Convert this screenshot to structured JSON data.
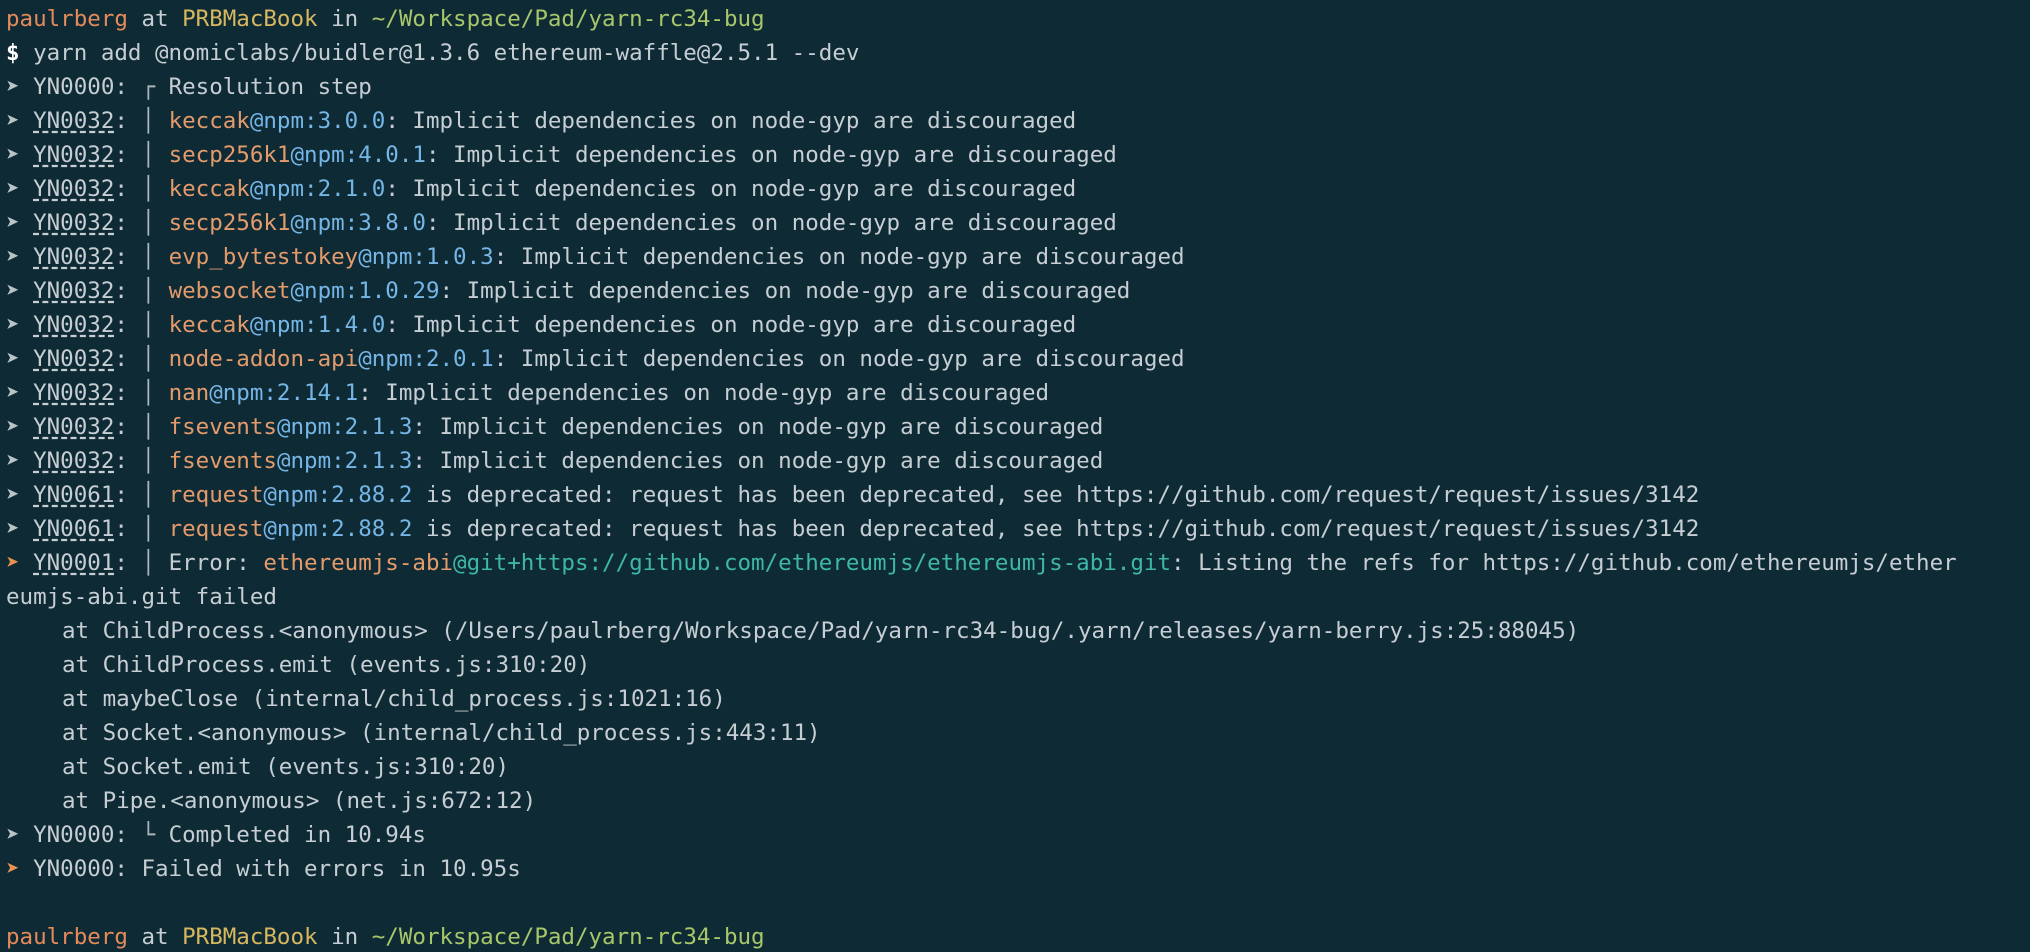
{
  "prompt": {
    "user": "paulrberg",
    "at": "at",
    "host": "PRBMacBook",
    "in": "in",
    "path": "~/Workspace/Pad/yarn-rc34-bug"
  },
  "command": {
    "prefix": "$",
    "text": "yarn add @nomiclabs/buidler@1.3.6 ethereum-waffle@2.5.1 --dev"
  },
  "steps": [
    {
      "code": "YN0000",
      "sep": ":",
      "pipe": "┌",
      "text": "Resolution step"
    }
  ],
  "warnings": [
    {
      "code": "YN0032",
      "name": "keccak",
      "ver": "@npm:3.0.0",
      "msg": ": Implicit dependencies on node-gyp are discouraged"
    },
    {
      "code": "YN0032",
      "name": "secp256k1",
      "ver": "@npm:4.0.1",
      "msg": ": Implicit dependencies on node-gyp are discouraged"
    },
    {
      "code": "YN0032",
      "name": "keccak",
      "ver": "@npm:2.1.0",
      "msg": ": Implicit dependencies on node-gyp are discouraged"
    },
    {
      "code": "YN0032",
      "name": "secp256k1",
      "ver": "@npm:3.8.0",
      "msg": ": Implicit dependencies on node-gyp are discouraged"
    },
    {
      "code": "YN0032",
      "name": "evp_bytestokey",
      "ver": "@npm:1.0.3",
      "msg": ": Implicit dependencies on node-gyp are discouraged"
    },
    {
      "code": "YN0032",
      "name": "websocket",
      "ver": "@npm:1.0.29",
      "msg": ": Implicit dependencies on node-gyp are discouraged"
    },
    {
      "code": "YN0032",
      "name": "keccak",
      "ver": "@npm:1.4.0",
      "msg": ": Implicit dependencies on node-gyp are discouraged"
    },
    {
      "code": "YN0032",
      "name": "node-addon-api",
      "ver": "@npm:2.0.1",
      "msg": ": Implicit dependencies on node-gyp are discouraged"
    },
    {
      "code": "YN0032",
      "name": "nan",
      "ver": "@npm:2.14.1",
      "msg": ": Implicit dependencies on node-gyp are discouraged"
    },
    {
      "code": "YN0032",
      "name": "fsevents",
      "ver": "@npm:2.1.3",
      "msg": ": Implicit dependencies on node-gyp are discouraged"
    },
    {
      "code": "YN0032",
      "name": "fsevents",
      "ver": "@npm:2.1.3",
      "msg": ": Implicit dependencies on node-gyp are discouraged"
    },
    {
      "code": "YN0061",
      "name": "request",
      "ver": "@npm:2.88.2",
      "msg": " is deprecated: request has been deprecated, see https://github.com/request/request/issues/3142"
    },
    {
      "code": "YN0061",
      "name": "request",
      "ver": "@npm:2.88.2",
      "msg": " is deprecated: request has been deprecated, see https://github.com/request/request/issues/3142"
    }
  ],
  "error": {
    "code": "YN0001",
    "label": "Error: ",
    "name": "ethereumjs-abi",
    "ver": "@git+https://github.com/ethereumjs/ethereumjs-abi.git",
    "msg": ": Listing the refs for https://github.com/ethereumjs/ether",
    "cont": "eumjs-abi.git failed",
    "stack": [
      "at ChildProcess.<anonymous> (/Users/paulrberg/Workspace/Pad/yarn-rc34-bug/.yarn/releases/yarn-berry.js:25:88045)",
      "at ChildProcess.emit (events.js:310:20)",
      "at maybeClose (internal/child_process.js:1021:16)",
      "at Socket.<anonymous> (internal/child_process.js:443:11)",
      "at Socket.emit (events.js:310:20)",
      "at Pipe.<anonymous> (net.js:672:12)"
    ]
  },
  "completed": {
    "code": "YN0000",
    "pipe": "└",
    "text": "Completed in 10.94s"
  },
  "failed": {
    "code": "YN0000",
    "text": "Failed with errors in 10.95s"
  },
  "arrow": "➤",
  "colors": {
    "background": "#0e2a35",
    "text": "#c6ced3",
    "user": "#e58a5a",
    "host": "#d7b85f",
    "path": "#a8c66a",
    "package": "#e49b6c",
    "version": "#76b6e6",
    "git_ref": "#3fb7a8",
    "error_arrow": "#e89152"
  }
}
